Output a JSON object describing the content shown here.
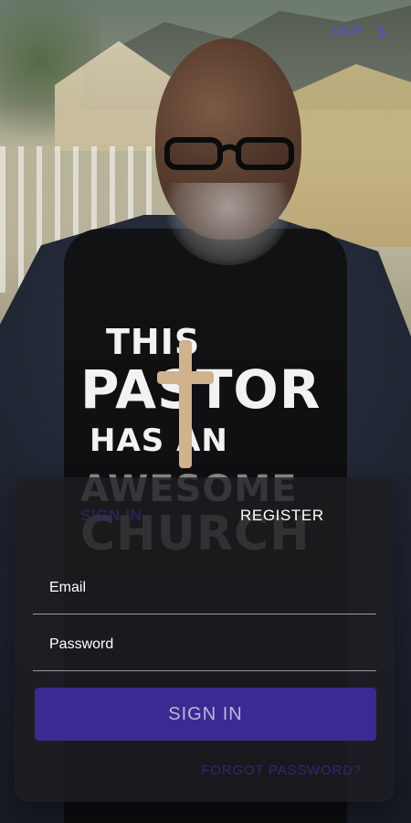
{
  "top": {
    "skip_label": "SKIP",
    "skip_icon": "chevron-right-icon"
  },
  "background": {
    "shirt_text_lines": [
      "THIS",
      "PASTOR",
      "HAS AN",
      "AWESOME",
      "CHURCH"
    ]
  },
  "auth": {
    "tabs": {
      "signin_label": "SIGN IN",
      "register_label": "REGISTER"
    },
    "fields": {
      "email_label": "Email",
      "email_value": "",
      "password_label": "Password",
      "password_value": ""
    },
    "primary_button_label": "SIGN IN",
    "forgot_password_label": "FORGOT PASSWORD?"
  },
  "colors": {
    "accent": "#5b4bd8",
    "primary_button_bg": "#3b2a92",
    "inactive_link": "#2f2a7c",
    "panel_bg": "rgba(30,30,33,0.78)"
  }
}
